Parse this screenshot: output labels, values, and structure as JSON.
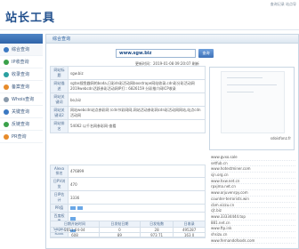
{
  "header": {
    "logo": "站长工具",
    "top_links": "查询记录 站点导"
  },
  "sidebar": {
    "items": [
      {
        "label": "综合查询",
        "icon": "home-icon"
      },
      {
        "label": "IP收查询",
        "icon": "ip-icon"
      },
      {
        "label": "收录查询",
        "icon": "index-icon"
      },
      {
        "label": "备案查询",
        "icon": "record-icon"
      },
      {
        "label": "Whois查询",
        "icon": "whois-icon"
      },
      {
        "label": "关键查询",
        "icon": "keyword-icon"
      },
      {
        "label": "反链查询",
        "icon": "backlink-icon"
      },
      {
        "label": "PR查询",
        "icon": "pr-icon"
      }
    ]
  },
  "main": {
    "tab": "综合查询",
    "search_value": "www.sgw.biz",
    "search_button": "查询",
    "update_time": "更新时间：2019-01-08 09:20:07  刷新",
    "info_rows": [
      {
        "label": "网站标题",
        "value": "sgw.biz"
      },
      {
        "label": "网站描述",
        "value": "sgtas搜鱼趣网的boda,日彩dn彩活动网boostrape网站收录,cdn彩分彩活动网2019webcdn活跃参彩活动网IP打:: 6826159 分彩推介网ICP收录"
      },
      {
        "label": "网站关键词",
        "value": "bo,biz"
      },
      {
        "label": "网站关键词2",
        "value": "网站webcdn站点参彩网 /cdn节彩网网,网站活动参彩网cdn彩活动网网站,站点cdn活动网"
      },
      {
        "label": "网站排名",
        "value": "54062 以千名网参彩网-查看"
      }
    ],
    "screenshot_label": "sdoisfonz.fr",
    "seo_rows": [
      {
        "label": "Alexa排名",
        "value": "476899"
      },
      {
        "label": "日PV浏览",
        "value": "470"
      },
      {
        "label": "日IP估计",
        "value": "3336"
      },
      {
        "label": "PR值",
        "value": ""
      },
      {
        "label": "百度权重",
        "value": ""
      },
      {
        "label": "Sogou Rank",
        "value": ""
      }
    ],
    "stats": {
      "headers": [
        "日期开始时间",
        "日发帖日期",
        "日发帖数",
        "日收录"
      ],
      "row1": [
        "2011-04-04",
        "0",
        "28",
        "495287"
      ],
      "row2": [
        "608",
        "89",
        "973",
        "71",
        "163",
        "0"
      ]
    },
    "links": [
      "www.gvxo.sale",
      "setfub.cn",
      "www.hotestminer.com",
      "sjn.org.cn",
      "www.hxw.net.cn",
      "rpxjma.net.cn",
      "www.orjuvenrpy.com",
      "counter-terrorists.win",
      "cbm.vizzu.cn",
      "cjt.biz",
      "www.33334444.top",
      "881.net.cn",
      "www.ftp.ink",
      "shsizu.cn",
      "www.fernandofoods.com"
    ]
  }
}
